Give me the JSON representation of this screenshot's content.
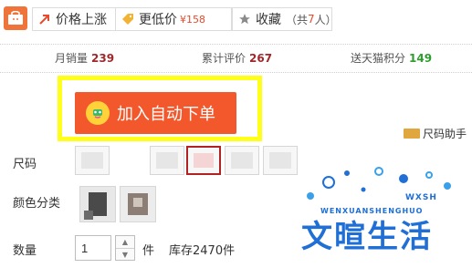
{
  "topbar": {
    "logo_icon": "tmall-bag-icon",
    "price_alert": {
      "icon": "arrow-up-right-icon",
      "label": "价格上涨"
    },
    "lower_price": {
      "icon": "price-tag-icon",
      "label": "更低价",
      "count": "¥158"
    },
    "favorite": {
      "icon": "star-icon",
      "label": "收藏",
      "count_prefix": "（共",
      "count": "7",
      "count_suffix": "人）"
    }
  },
  "stats": [
    {
      "label": "月销量",
      "value": "239"
    },
    {
      "label": "累计评价",
      "value": "267"
    },
    {
      "label": "送天猫积分",
      "value": "149"
    }
  ],
  "cta": {
    "label": "加入自动下单",
    "icon": "smiley-icon"
  },
  "size_guide": {
    "label": "尺码助手",
    "icon": "ruler-icon"
  },
  "size": {
    "label": "尺码"
  },
  "color": {
    "label": "颜色分类"
  },
  "quantity": {
    "label": "数量",
    "value": "1",
    "unit": "件",
    "stock": "库存2470件"
  },
  "watermark": {
    "big": "文暄生活",
    "small": "WENXUANSHENGHUO",
    "mark": "WXSH"
  },
  "colors": {
    "accent": "#f3582c",
    "highlight": "#ffff1a",
    "red": "#a0282a",
    "green": "#2e9c2e",
    "brand_blue": "#1f6fd6"
  }
}
